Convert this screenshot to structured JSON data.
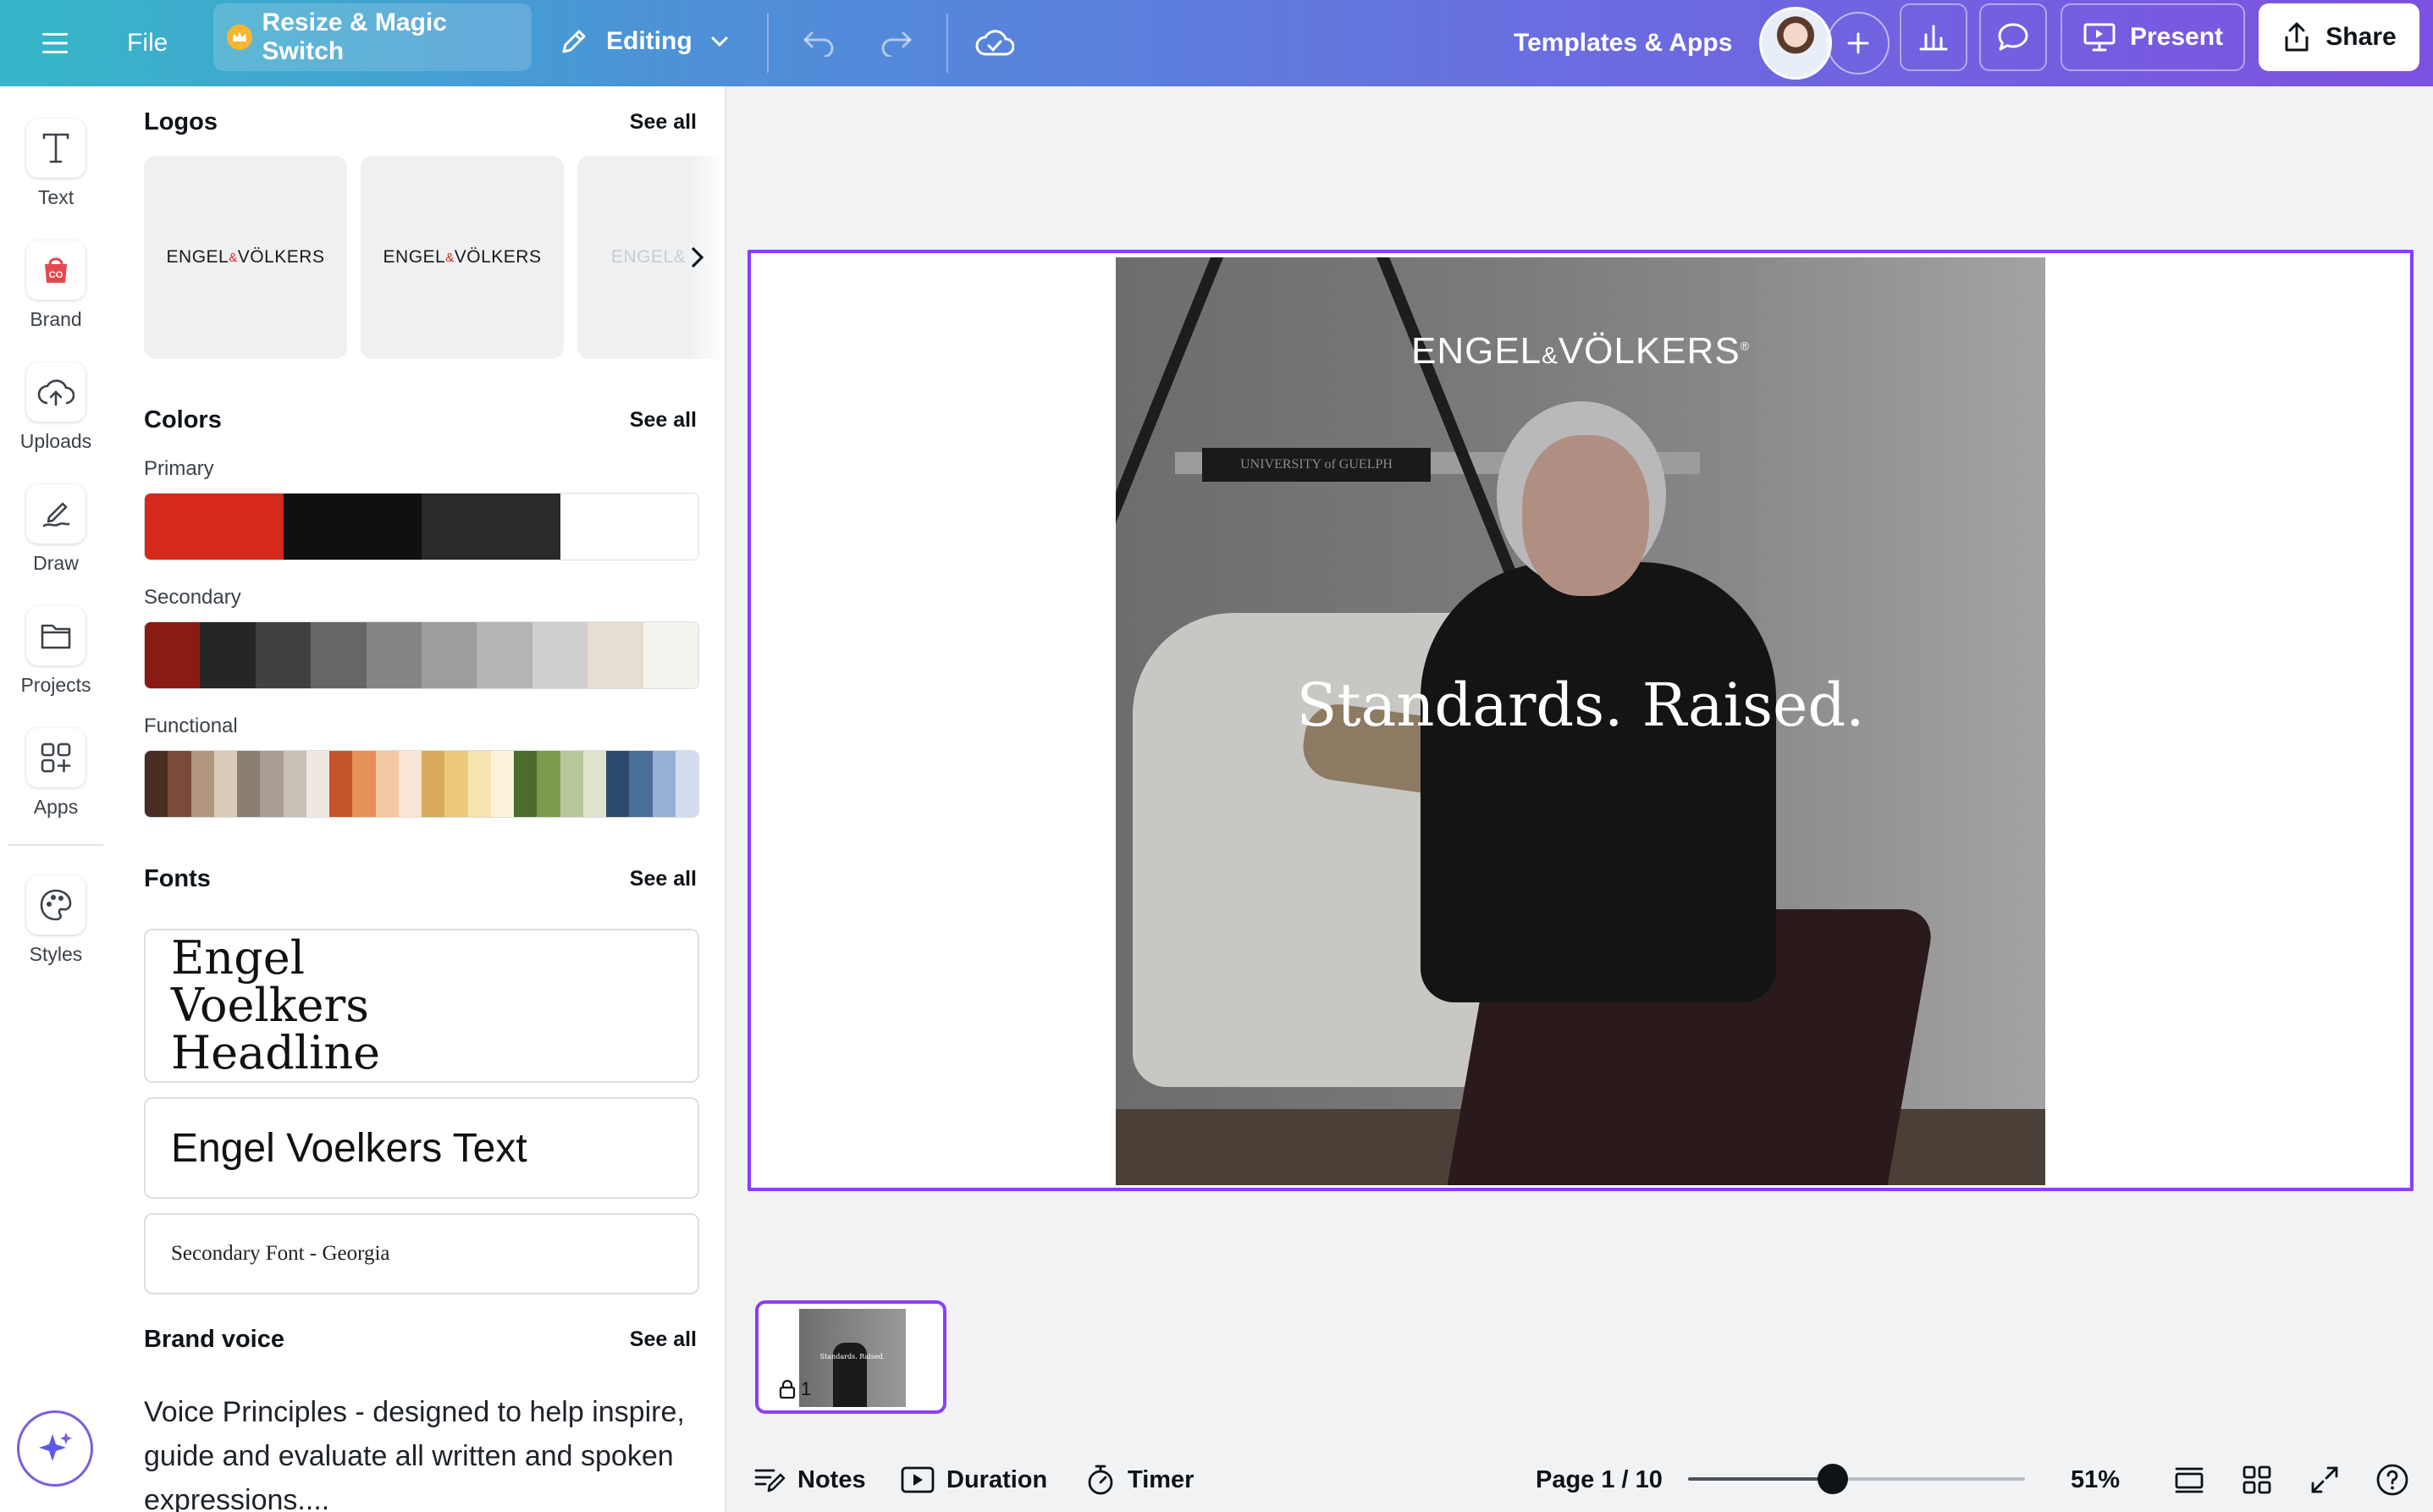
{
  "topbar": {
    "file_label": "File",
    "resize_label": "Resize & Magic Switch",
    "editing_label": "Editing",
    "templates_label": "Templates & Apps",
    "present_label": "Present",
    "share_label": "Share"
  },
  "rail": {
    "items": [
      {
        "label": "Text",
        "icon": "text-icon"
      },
      {
        "label": "Brand",
        "icon": "brand-icon"
      },
      {
        "label": "Uploads",
        "icon": "uploads-icon"
      },
      {
        "label": "Draw",
        "icon": "draw-icon"
      },
      {
        "label": "Projects",
        "icon": "folder-icon"
      },
      {
        "label": "Apps",
        "icon": "apps-icon"
      },
      {
        "label": "Styles",
        "icon": "palette-icon"
      }
    ]
  },
  "panel": {
    "logos": {
      "title": "Logos",
      "see_all": "See all",
      "logo_text_left": "ENGEL",
      "logo_text_amp": "&",
      "logo_text_right": "VÖLKERS",
      "logo_text_partial": "ENGEL&"
    },
    "colors": {
      "title": "Colors",
      "see_all": "See all",
      "primary_label": "Primary",
      "primary": [
        "#d5291e",
        "#101010",
        "#2a2a2a",
        "#ffffff"
      ],
      "secondary_label": "Secondary",
      "secondary": [
        "#8a1a14",
        "#252525",
        "#404040",
        "#666666",
        "#858585",
        "#9d9d9d",
        "#b5b5b5",
        "#cfcfcf",
        "#e6ddd3",
        "#f5f3ee"
      ],
      "functional_label": "Functional",
      "functional": [
        "#4a2c24",
        "#7a4a3a",
        "#b39680",
        "#d8cbb8",
        "#8a7e72",
        "#a89d92",
        "#c9c0b8",
        "#efe8e2",
        "#c2562a",
        "#e8905a",
        "#f3c8a6",
        "#f9e6d4",
        "#d9aa5a",
        "#ecc97a",
        "#f6e3b0",
        "#fbf2d9",
        "#4d6b2a",
        "#7d9a4e",
        "#b8c79a",
        "#dde3cc",
        "#2b4a6e",
        "#4a6e98",
        "#98afd4",
        "#d3ddef"
      ]
    },
    "fonts": {
      "title": "Fonts",
      "see_all": "See all",
      "headline_font": "Engel Voelkers Headline",
      "text_font": "Engel Voelkers Text",
      "secondary_font": "Secondary Font - Georgia"
    },
    "brand_voice": {
      "title": "Brand voice",
      "see_all": "See all",
      "text": "Voice Principles - designed to help inspire, guide and evaluate all written and spoken expressions...."
    }
  },
  "canvas": {
    "logo_left": "ENGEL",
    "logo_amp": "&",
    "logo_right": "VÖLKERS",
    "logo_mark": "®",
    "headline": "Standards. Raised.",
    "book_text": "UNIVERSITY of GUELPH",
    "thumb_page_number": "1"
  },
  "bottombar": {
    "notes_label": "Notes",
    "duration_label": "Duration",
    "timer_label": "Timer",
    "page_indicator": "Page 1 / 10",
    "zoom_value": "51%",
    "zoom_level": 0.43
  }
}
